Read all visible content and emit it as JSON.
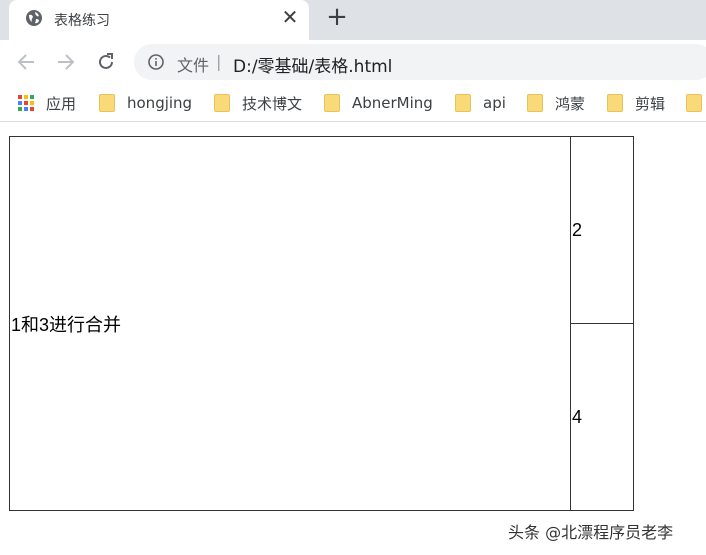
{
  "browser": {
    "tab": {
      "title": "表格练习",
      "icon": "globe-icon",
      "close": "✕"
    },
    "new_tab": "+",
    "nav": {
      "back": "back-arrow-icon",
      "forward": "forward-arrow-icon",
      "reload": "reload-icon"
    },
    "omnibox": {
      "scheme_label": "文件",
      "divider": "|",
      "url": "D:/零基础/表格.html"
    },
    "bookmarks": [
      {
        "label": "应用",
        "icon": "apps-grid-icon"
      },
      {
        "label": "hongjing",
        "icon": "folder-icon"
      },
      {
        "label": "技术博文",
        "icon": "folder-icon"
      },
      {
        "label": "AbnerMing",
        "icon": "folder-icon"
      },
      {
        "label": "api",
        "icon": "folder-icon"
      },
      {
        "label": "鸿蒙",
        "icon": "folder-icon"
      },
      {
        "label": "剪辑",
        "icon": "folder-icon"
      }
    ]
  },
  "page": {
    "table": {
      "cell_1": "1和3进行合并",
      "cell_2": "2",
      "cell_4": "4"
    },
    "watermark": "头条 @北漂程序员老李"
  },
  "colors": {
    "tabbar_bg": "#dee1e6",
    "omnibox_bg": "#f1f3f4",
    "table_border": "#333333",
    "folder": "#f9d978"
  }
}
